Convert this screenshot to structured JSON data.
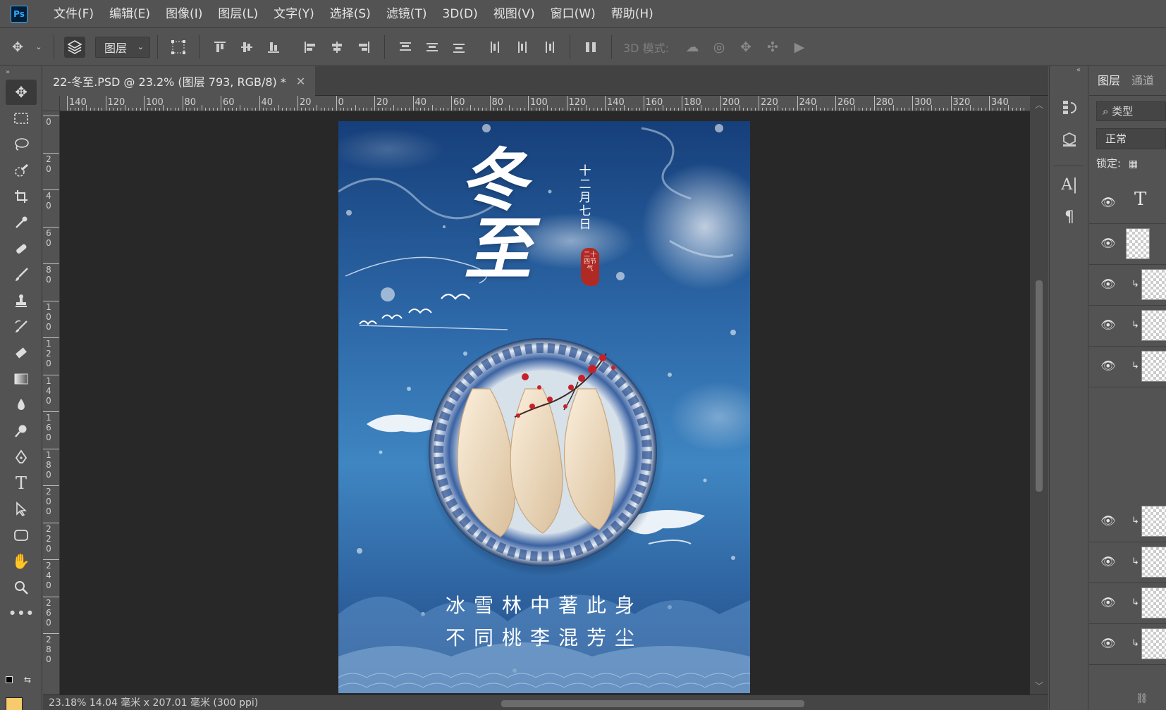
{
  "app": {
    "logo": "Ps"
  },
  "menu": [
    "文件(F)",
    "编辑(E)",
    "图像(I)",
    "图层(L)",
    "文字(Y)",
    "选择(S)",
    "滤镜(T)",
    "3D(D)",
    "视图(V)",
    "窗口(W)",
    "帮助(H)"
  ],
  "options": {
    "auto_select_target": "图层",
    "mode3d_label": "3D 模式:"
  },
  "document": {
    "tab_title": "22-冬至.PSD @ 23.2% (图层 793, RGB/8) *",
    "status": "23.18%   14.04 毫米 x 207.01 毫米 (300 ppi)"
  },
  "ruler": {
    "h_labels": [
      "140",
      "120",
      "100",
      "80",
      "60",
      "40",
      "20",
      "0",
      "20",
      "40",
      "60",
      "80",
      "100",
      "120",
      "140",
      "160",
      "180",
      "200",
      "220",
      "240",
      "260",
      "280",
      "300",
      "320",
      "340"
    ],
    "v_labels": [
      "0",
      "20",
      "40",
      "60",
      "80",
      "100",
      "120",
      "140",
      "160",
      "180",
      "200",
      "220",
      "240",
      "260",
      "280"
    ]
  },
  "poster": {
    "title_chars": [
      "冬",
      "至"
    ],
    "date_vertical": "十二月七日",
    "seal_text": "二十四节气",
    "poem_lines": [
      "冰雪林中著此身",
      "不同桃李混芳尘"
    ],
    "colors": {
      "sky_top": "#163f7a",
      "sky_mid": "#3f86c2",
      "seal": "#b02a25",
      "plate_blue": "#2b4f8f"
    }
  },
  "layers_panel": {
    "tabs": [
      "图层",
      "通道"
    ],
    "filter_label": "类型",
    "blend_mode": "正常",
    "lock_label": "锁定:"
  }
}
